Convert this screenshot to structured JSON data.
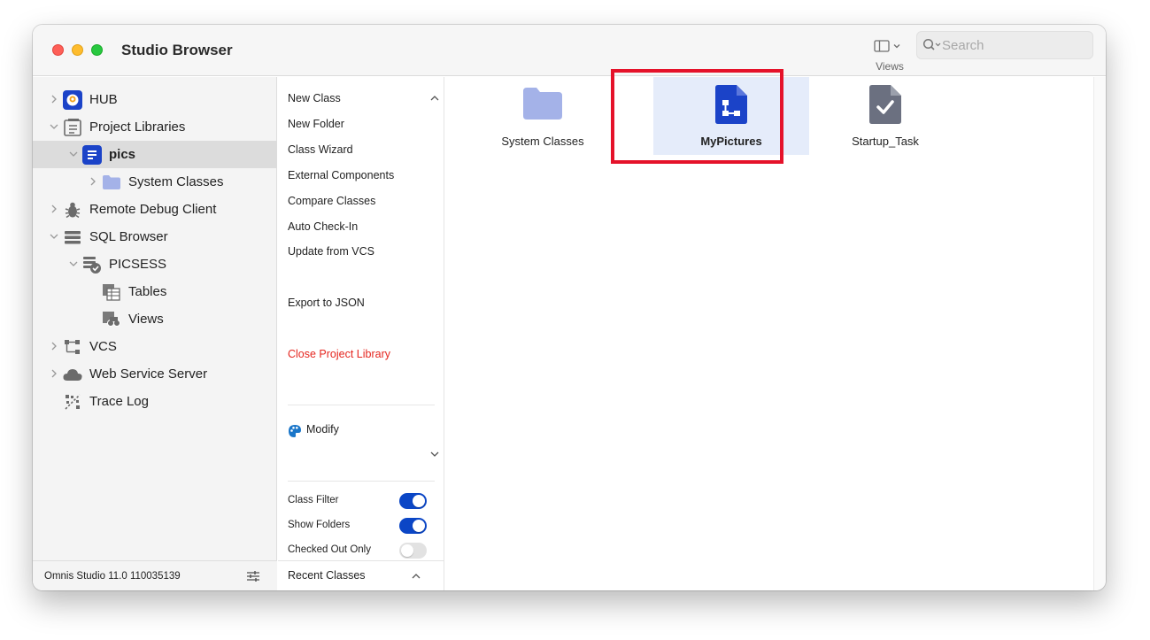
{
  "window": {
    "title": "Studio Browser"
  },
  "toolbar": {
    "views_label": "Views",
    "search_placeholder": "Search"
  },
  "sidebar": {
    "items": [
      {
        "label": "HUB",
        "icon": "hub-icon"
      },
      {
        "label": "Project Libraries",
        "icon": "project-libraries-icon"
      },
      {
        "label": "pics",
        "icon": "library-icon"
      },
      {
        "label": "System Classes",
        "icon": "folder-icon"
      },
      {
        "label": "Remote Debug Client",
        "icon": "bug-icon"
      },
      {
        "label": "SQL Browser",
        "icon": "sql-browser-icon"
      },
      {
        "label": "PICSESS",
        "icon": "session-icon"
      },
      {
        "label": "Tables",
        "icon": "tables-icon"
      },
      {
        "label": "Views",
        "icon": "views-icon"
      },
      {
        "label": "VCS",
        "icon": "vcs-icon"
      },
      {
        "label": "Web Service Server",
        "icon": "cloud-icon"
      },
      {
        "label": "Trace Log",
        "icon": "trace-log-icon"
      }
    ],
    "footer": "Omnis Studio 11.0 110035139"
  },
  "actions": {
    "items": [
      "New Class",
      "New Folder",
      "Class Wizard",
      "External Components",
      "Compare Classes",
      "Auto Check-In",
      "Update from VCS"
    ],
    "export": "Export to JSON",
    "close": "Close Project Library",
    "modify": "Modify",
    "toggles": [
      {
        "label": "Class Filter",
        "on": true
      },
      {
        "label": "Show Folders",
        "on": true
      },
      {
        "label": "Checked Out Only",
        "on": false
      }
    ],
    "recent": "Recent Classes"
  },
  "main": {
    "items": [
      {
        "label": "System Classes",
        "icon": "folder-icon",
        "selected": false
      },
      {
        "label": "MyPictures",
        "icon": "remote-form-icon",
        "selected": true
      },
      {
        "label": "Startup_Task",
        "icon": "task-icon",
        "selected": false
      }
    ]
  },
  "colors": {
    "accent": "#0b46c6",
    "danger": "#e5261f",
    "highlight": "#e5122a",
    "folder": "#a4b2e8"
  }
}
